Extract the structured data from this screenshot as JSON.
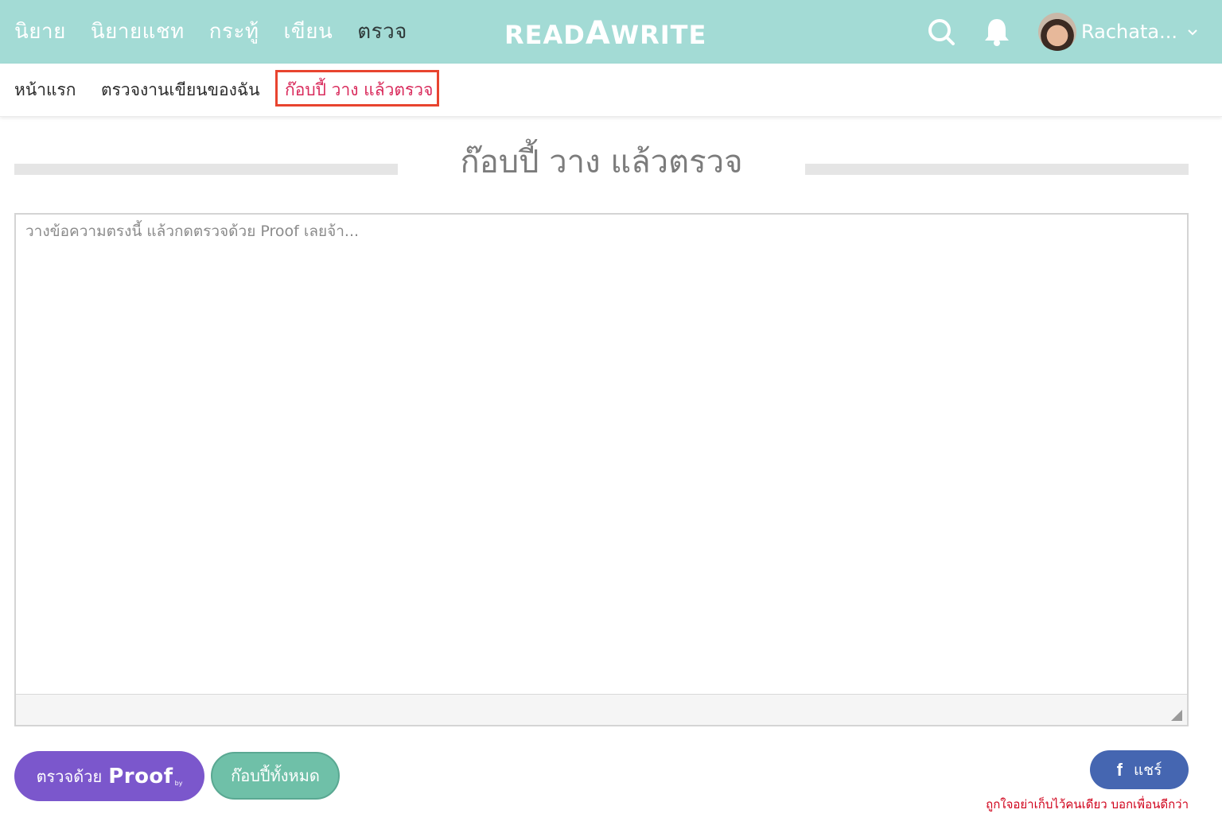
{
  "header": {
    "nav": [
      "นิยาย",
      "นิยายแชท",
      "กระทู้",
      "เขียน",
      "ตรวจ"
    ],
    "active_nav": "ตรวจ",
    "logo_left": "READ",
    "logo_mid": "A",
    "logo_right": "WRITE",
    "search_icon": "search-icon",
    "notification_icon": "bell-icon",
    "username": "Rachata...",
    "bg_color": "#a3dbd5"
  },
  "subnav": {
    "items": [
      "หน้าแรก",
      "ตรวจงานเขียนของฉัน",
      "ก๊อบปี้ วาง แล้วตรวจ"
    ],
    "active": "ก๊อบปี้ วาง แล้วตรวจ"
  },
  "main": {
    "title": "ก๊อบปี้ วาง แล้วตรวจ",
    "textarea_placeholder": "วางข้อความตรงนี้ แล้วกดตรวจด้วย Proof เลยจ้า...",
    "textarea_value": ""
  },
  "actions": {
    "proof_label": "ตรวจด้วย",
    "proof_brand": "Proof",
    "proof_by": "by",
    "copy_all_label": "ก๊อบปี้ทั้งหมด",
    "share_icon": "f",
    "share_label": "แชร์",
    "share_note": "ถูกใจอย่าเก็บไว้คนเดียว บอกเพื่อนดีกว่า"
  },
  "colors": {
    "accent_teal": "#a3dbd5",
    "active_pink": "#d92b5c",
    "highlight_red": "#e8442f",
    "proof_purple": "#7b57cc",
    "copy_green": "#6fc0a8",
    "facebook_blue": "#4566b1",
    "note_red": "#d0021b"
  }
}
